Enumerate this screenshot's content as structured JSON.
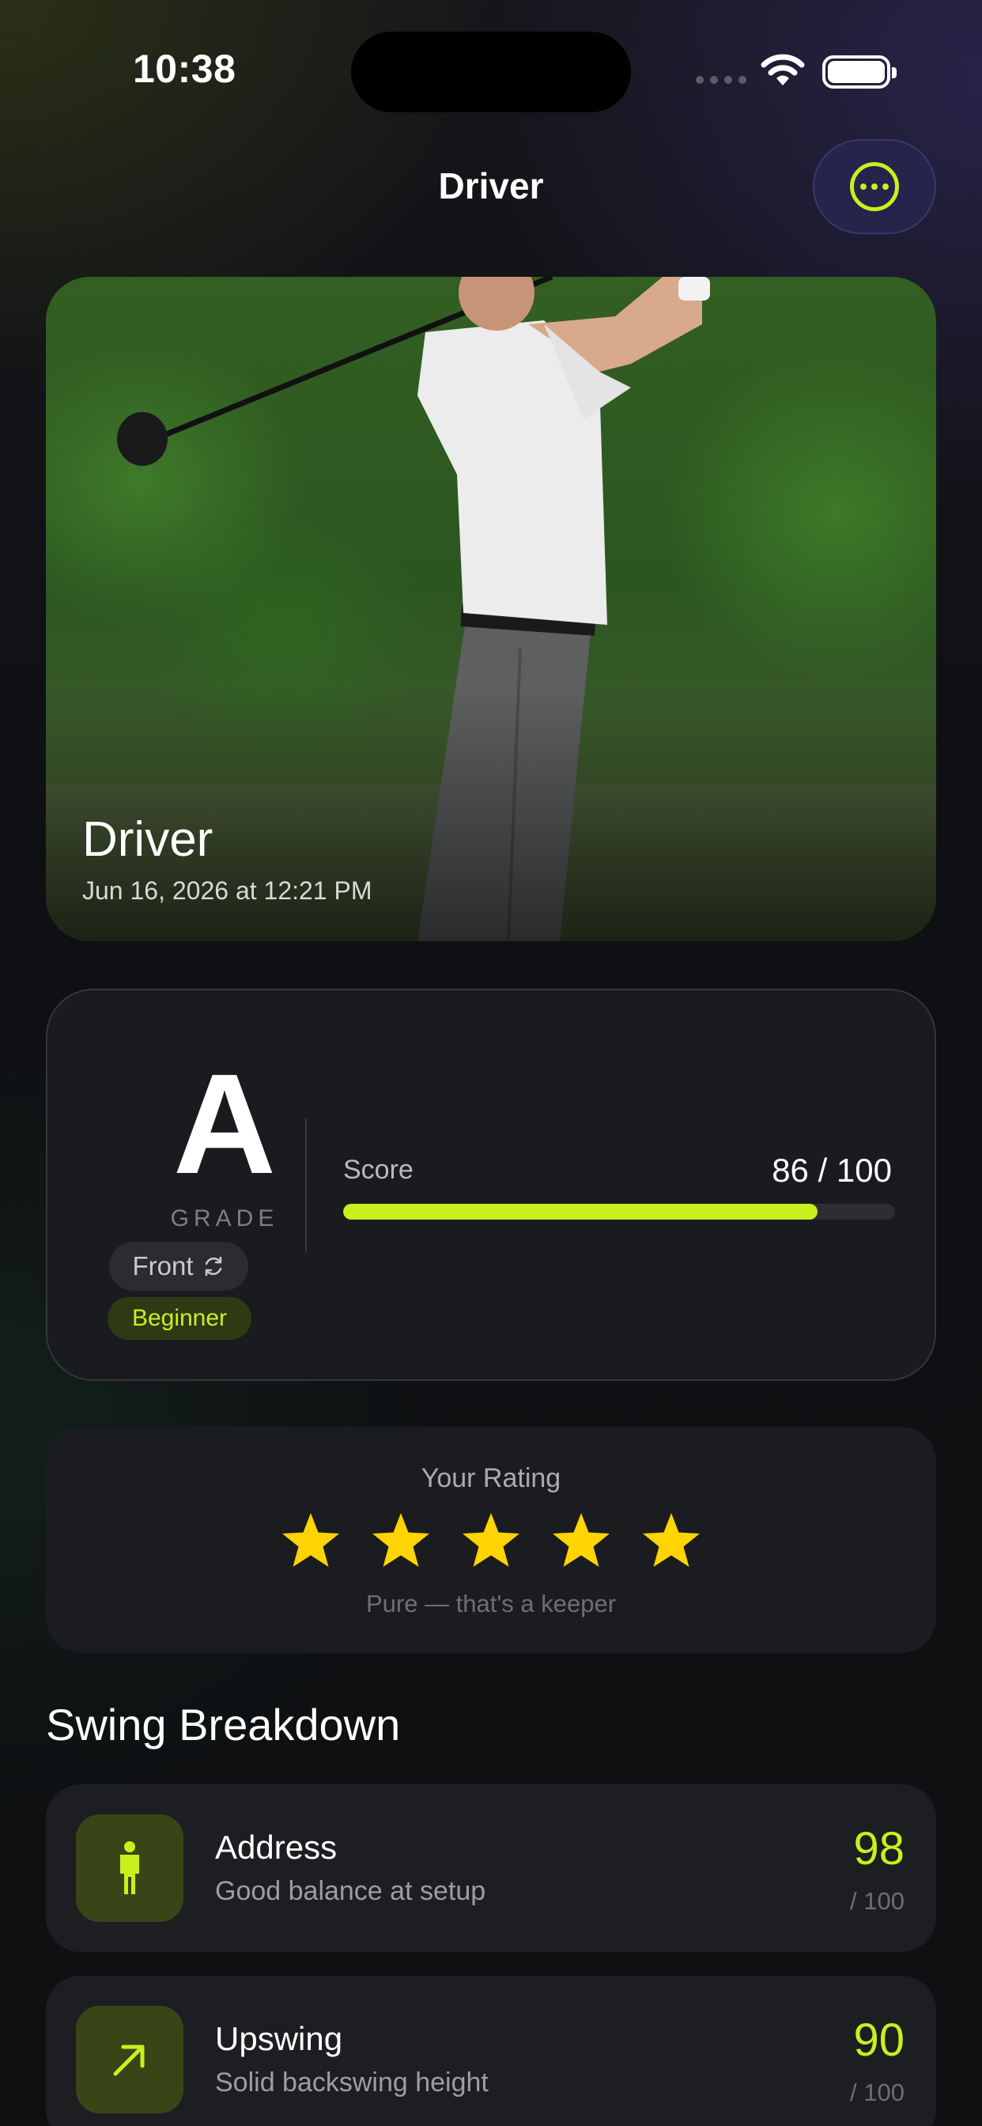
{
  "status_bar": {
    "time": "10:38"
  },
  "nav": {
    "title": "Driver",
    "more_icon": "ellipsis-circle-icon"
  },
  "hero": {
    "title": "Driver",
    "date": "Jun 16, 2026 at 12:21 PM"
  },
  "grade_card": {
    "grade": "A",
    "grade_label": "GRADE",
    "view": "Front",
    "level": "Beginner",
    "score_label": "Score",
    "score_text": "86 / 100",
    "score_fraction": 0.86
  },
  "rating": {
    "title": "Your Rating",
    "stars": 5,
    "caption": "Pure — that's a keeper"
  },
  "breakdown": {
    "title": "Swing Breakdown",
    "phases": [
      {
        "name": "Address",
        "description": "Good balance at setup",
        "score": "98",
        "max": "/ 100",
        "icon": "person-standing-icon"
      },
      {
        "name": "Upswing",
        "description": "Solid backswing height",
        "score": "90",
        "max": "/ 100",
        "icon": "arrow-up-right-icon"
      }
    ]
  },
  "colors": {
    "accent": "#c8f01e",
    "star": "#ffd400",
    "card": "#1a1b1f",
    "more_button_bg": "#25244a"
  }
}
